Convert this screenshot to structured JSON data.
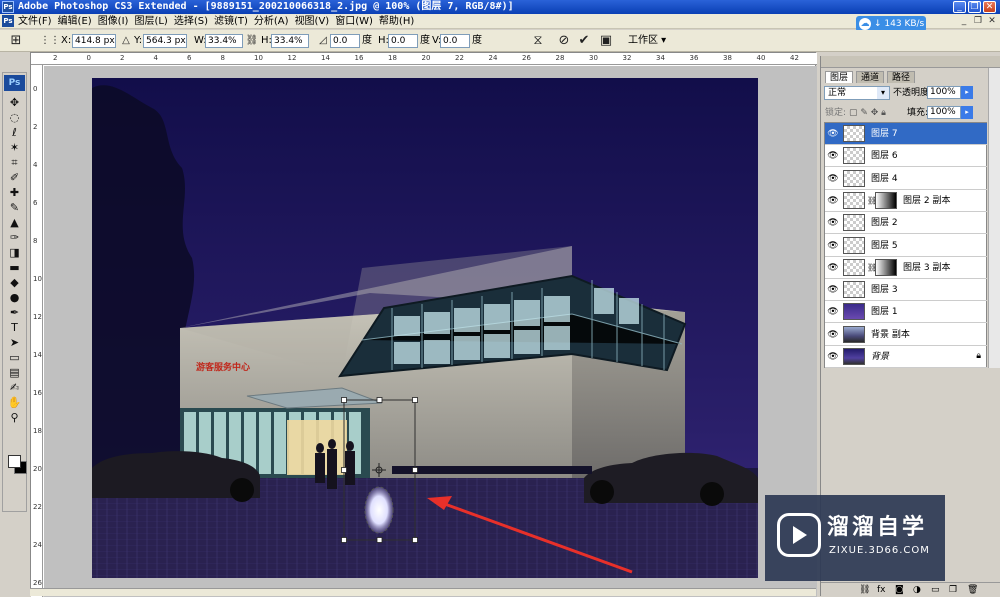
{
  "window": {
    "title": "Adobe Photoshop CS3 Extended - [9889151_200210066318_2.jpg @ 100% (图层 7, RGB/8#)]",
    "app_icon": "Ps"
  },
  "menu": {
    "items": [
      "文件(F)",
      "编辑(E)",
      "图像(I)",
      "图层(L)",
      "选择(S)",
      "滤镜(T)",
      "分析(A)",
      "视图(V)",
      "窗口(W)",
      "帮助(H)"
    ]
  },
  "network": {
    "speed": "143 KB/s"
  },
  "options": {
    "x_label": "X:",
    "x_value": "414.8 px",
    "y_label": "Y:",
    "y_value": "564.3 px",
    "w_label": "W:",
    "w_value": "33.4%",
    "h_label": "H:",
    "h_value": "33.4%",
    "angle_value": "0.0",
    "angle_unit": "度",
    "hskew_label": "H:",
    "hskew_value": "0.0",
    "hskew_unit": "度",
    "vskew_label": "V:",
    "vskew_value": "0.0",
    "vskew_unit": "度",
    "workspace_label": "工作区"
  },
  "toolbox": {
    "logo": "Ps",
    "tools": [
      "move-tool",
      "marquee-tool",
      "lasso-tool",
      "magic-wand-tool",
      "crop-tool",
      "slice-tool",
      "healing-tool",
      "brush-tool",
      "stamp-tool",
      "history-brush-tool",
      "eraser-tool",
      "gradient-tool",
      "blur-tool",
      "dodge-tool",
      "pen-tool",
      "type-tool",
      "path-select-tool",
      "shape-tool",
      "notes-tool",
      "eyedropper-tool",
      "hand-tool",
      "zoom-tool"
    ],
    "glyphs": [
      "✥",
      "◌",
      "ℓ",
      "✶",
      "⌗",
      "✐",
      "✚",
      "✎",
      "▲",
      "✑",
      "◨",
      "▬",
      "◆",
      "●",
      "✒",
      "T",
      "➤",
      "▭",
      "▤",
      "✍",
      "✋",
      "⚲"
    ]
  },
  "ruler": {
    "top_ticks": [
      "2",
      "0",
      "2",
      "4",
      "6",
      "8",
      "10",
      "12",
      "14",
      "16",
      "18",
      "20",
      "22",
      "24",
      "26",
      "28",
      "30",
      "32",
      "34",
      "36",
      "38",
      "40",
      "42"
    ],
    "left_ticks": [
      "0",
      "2",
      "4",
      "6",
      "8",
      "10",
      "12",
      "14",
      "16",
      "18",
      "20",
      "22",
      "24",
      "26"
    ]
  },
  "scene": {
    "sign_text": "游客服务中心"
  },
  "layers_panel": {
    "tabs": [
      "图层",
      "通道",
      "路径"
    ],
    "blend_mode": "正常",
    "opacity_label": "不透明度:",
    "opacity_value": "100%",
    "lock_label": "锁定:",
    "fill_label": "填充:",
    "fill_value": "100%",
    "layers": [
      {
        "name": "图层 7",
        "thumb": "transparent",
        "selected": true
      },
      {
        "name": "图层 6",
        "thumb": "transparent"
      },
      {
        "name": "图层 4",
        "thumb": "transparent"
      },
      {
        "name": "图层 2 副本",
        "thumb": "transparent",
        "mask": true
      },
      {
        "name": "图层 2",
        "thumb": "transparent"
      },
      {
        "name": "图层 5",
        "thumb": "transparent"
      },
      {
        "name": "图层 3 副本",
        "thumb": "transparent",
        "mask": true
      },
      {
        "name": "图层 3",
        "thumb": "transparent"
      },
      {
        "name": "图层 1",
        "thumb": "purple"
      },
      {
        "name": "背景 副本",
        "thumb": "photo2"
      },
      {
        "name": "背景",
        "thumb": "photo",
        "locked": true
      }
    ]
  },
  "watermark": {
    "brand": "溜溜自学",
    "url": "ZIXUE.3D66.COM"
  },
  "colors": {
    "selection": "#316ac5",
    "sky_top": "#120e4a",
    "sky_bottom": "#3b2a7e",
    "arrow": "#e8302a"
  }
}
